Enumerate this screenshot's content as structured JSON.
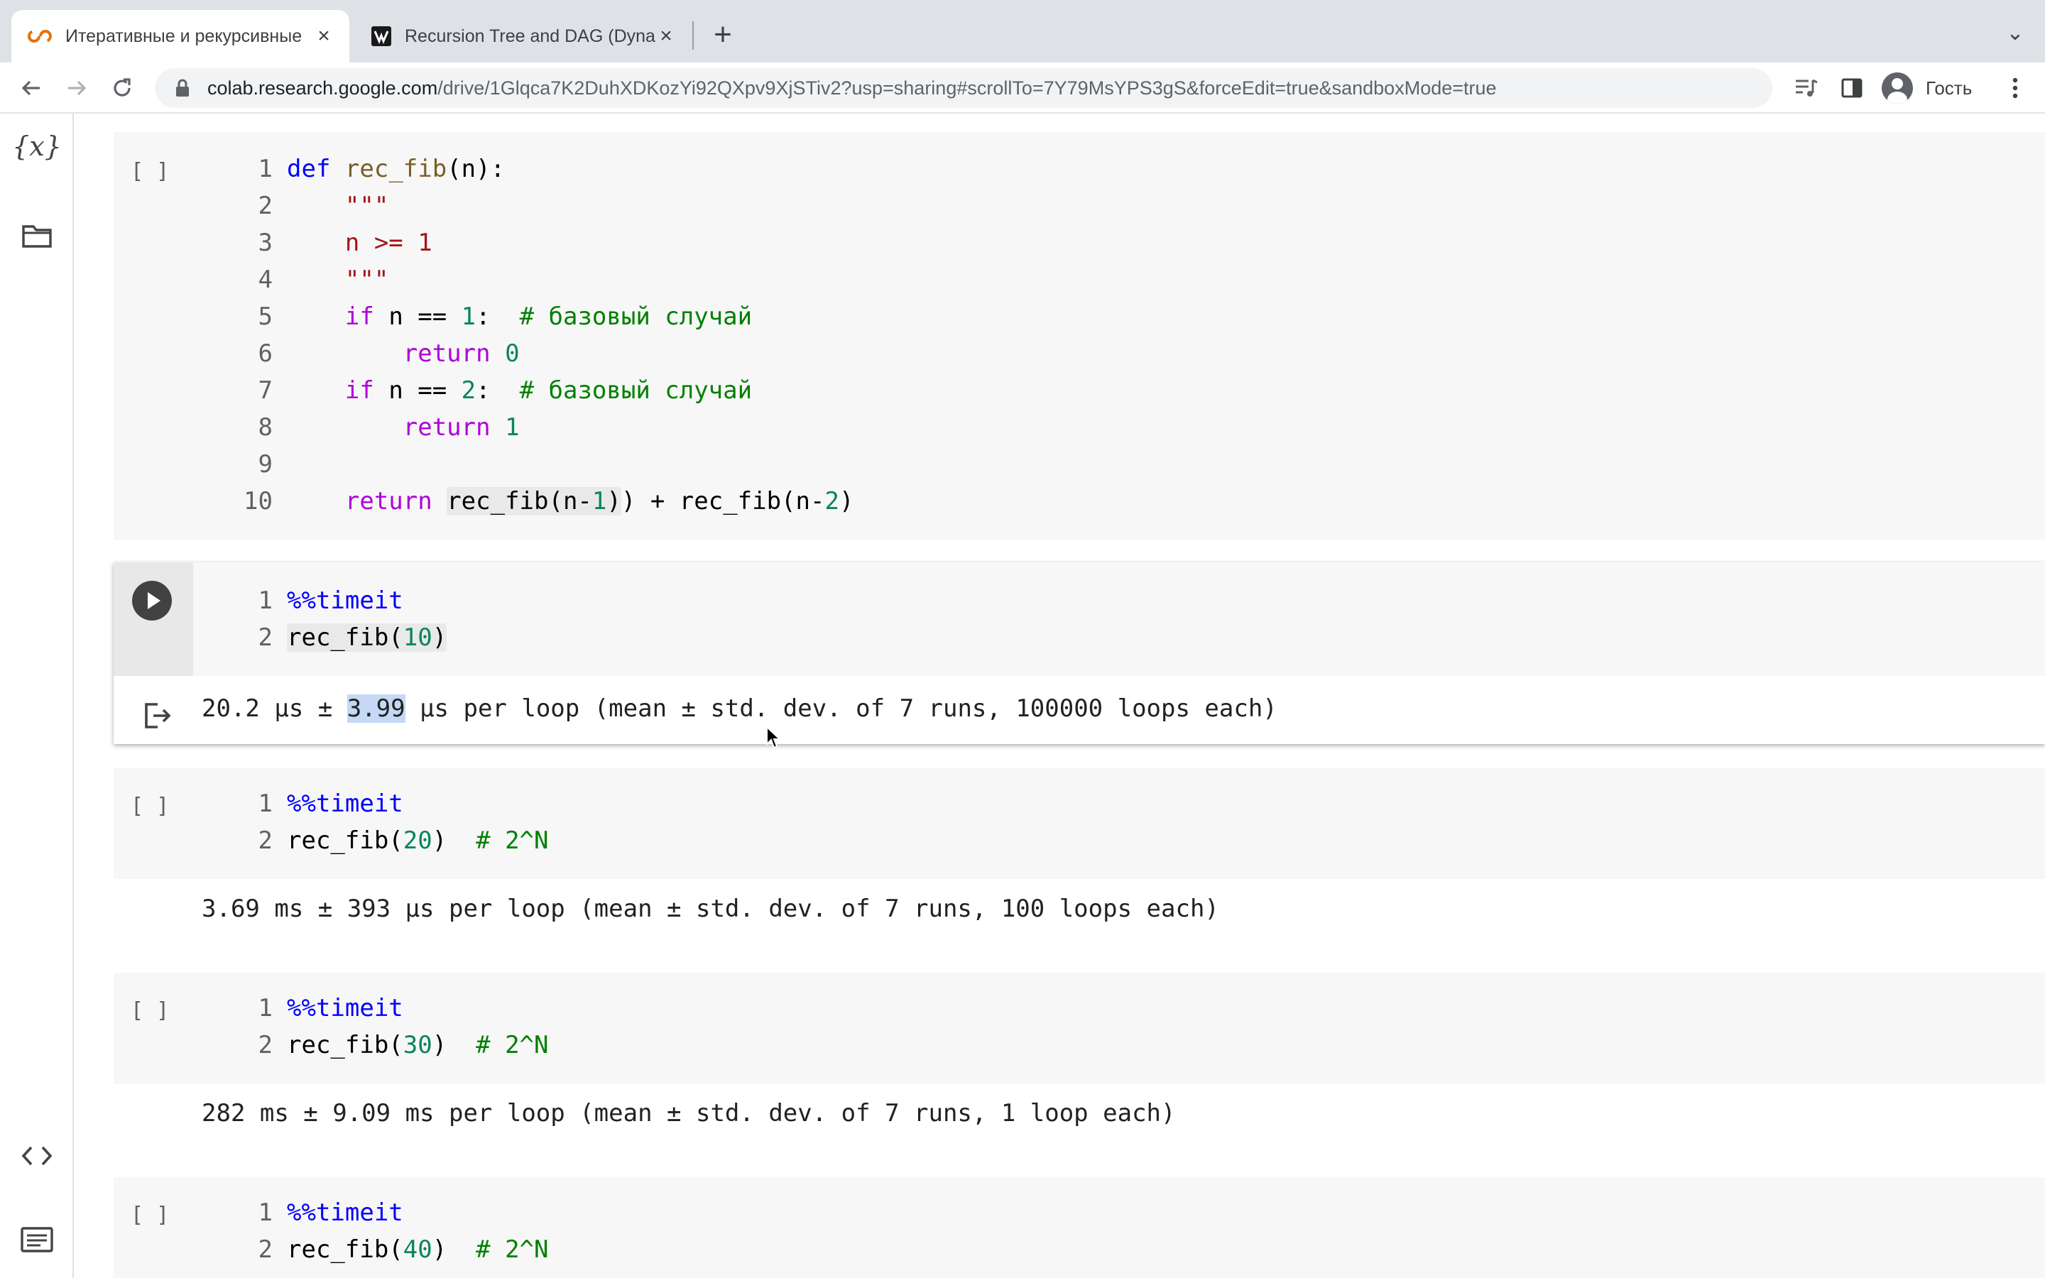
{
  "browser": {
    "tabs": [
      {
        "title": "Итеративные и рекурсивные",
        "favicon": "colab-logo-icon",
        "close": "×"
      },
      {
        "title": "Recursion Tree and DAG (Dyna",
        "favicon": "visualgo-logo-icon",
        "close": "×"
      }
    ],
    "new_tab": "+",
    "tab_menu": "⌄",
    "url_host": "colab.research.google.com",
    "url_path": "/drive/1Glqca7K2DuhXDKozYi92QXpv9XjSTiv2?usp=sharing#scrollTo=7Y79MsYPS3gS&forceEdit=true&sandboxMode=true",
    "profile_label": "Гость"
  },
  "colab": {
    "rail_icons": [
      "variables-icon",
      "folder-icon",
      "code-snippets-icon",
      "terminal-icon"
    ],
    "variables_label": "{x}",
    "cells": [
      {
        "bracket": "[ ]",
        "line_numbers": [
          "1",
          "2",
          "3",
          "4",
          "5",
          "6",
          "7",
          "8",
          "9",
          "10"
        ],
        "code_lines": [
          "def rec_fib(n):",
          "    \"\"\"",
          "    n >= 1",
          "    \"\"\"",
          "    if n == 1:  # базовый случай",
          "        return 0",
          "    if n == 2:  # базовый случай",
          "        return 1",
          "",
          "    return rec_fib(n-1) + rec_fib(n-2)"
        ]
      },
      {
        "bracket": "",
        "line_numbers": [
          "1",
          "2"
        ],
        "code_lines": [
          "%%timeit",
          "rec_fib(10)"
        ],
        "output": "20.2 µs ± 3.99 µs per loop (mean ± std. dev. of 7 runs, 100000 loops each)",
        "output_selection": "3.99"
      },
      {
        "bracket": "[ ]",
        "line_numbers": [
          "1",
          "2"
        ],
        "code_lines": [
          "%%timeit",
          "rec_fib(20)  # 2^N"
        ],
        "output": "3.69 ms ± 393 µs per loop (mean ± std. dev. of 7 runs, 100 loops each)"
      },
      {
        "bracket": "[ ]",
        "line_numbers": [
          "1",
          "2"
        ],
        "code_lines": [
          "%%timeit",
          "rec_fib(30)  # 2^N"
        ],
        "output": "282 ms ± 9.09 ms per loop (mean ± std. dev. of 7 runs, 1 loop each)"
      },
      {
        "bracket": "[ ]",
        "line_numbers": [
          "1",
          "2"
        ],
        "code_lines": [
          "%%timeit",
          "rec_fib(40)  # 2^N"
        ]
      }
    ],
    "code_tokens": {
      "c0": {
        "l1_def": "def",
        "l1_fn": "rec_fib",
        "l1_rest": "(n):",
        "q": "\"\"\"",
        "l3": "n >= 1",
        "if": "if",
        "cond1": " n == ",
        "one": "1",
        "colon": ":  ",
        "comment": "# базовый случай",
        "ret": "return",
        "zero": "0",
        "two": "2",
        "l10_call1": "rec_fib(n-",
        "l10_plus": ") + rec_fib(n-",
        "l10_end": ")"
      },
      "magic": "%%timeit",
      "fn": "rec_fib(",
      "arg10": "10",
      "arg20": "20",
      "arg30": "30",
      "arg40": "40",
      "close": ")",
      "cm": "  # 2^N"
    },
    "out_parts": {
      "pre": "20.2 µs ± ",
      "sel": "3.99",
      "post": " µs per loop (mean ± std. dev. of 7 runs, 100000 loops each)"
    }
  }
}
